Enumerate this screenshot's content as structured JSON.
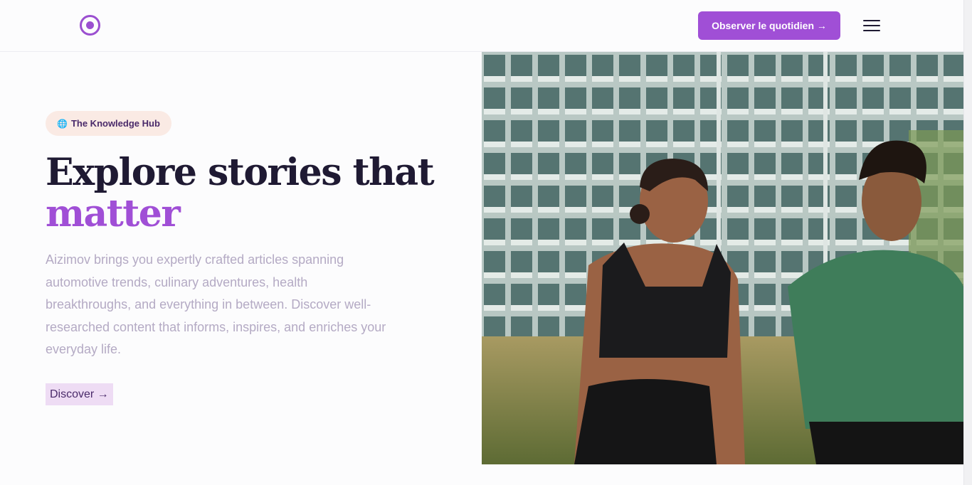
{
  "header": {
    "cta_label": "Observer le quotidien →",
    "logo_icon": "target-circle-icon",
    "menu_icon": "hamburger-menu-icon"
  },
  "hero": {
    "badge_icon": "🌐",
    "badge_label": "The Knowledge Hub",
    "title_line1": "Explore stories that",
    "title_line2": "matter",
    "description": "Aizimov brings you expertly crafted articles spanning automotive trends, culinary adventures, health breakthroughs, and everything in between. Discover well-researched content that informs, inspires, and enriches your everyday life.",
    "discover_label": "Discover →",
    "image_alt": "Two people jogging outdoors in front of a glass apartment building"
  },
  "colors": {
    "accent": "#a04fd6",
    "heading": "#1f1a33",
    "body_text": "#b4aac4",
    "badge_bg": "#faeae4"
  }
}
